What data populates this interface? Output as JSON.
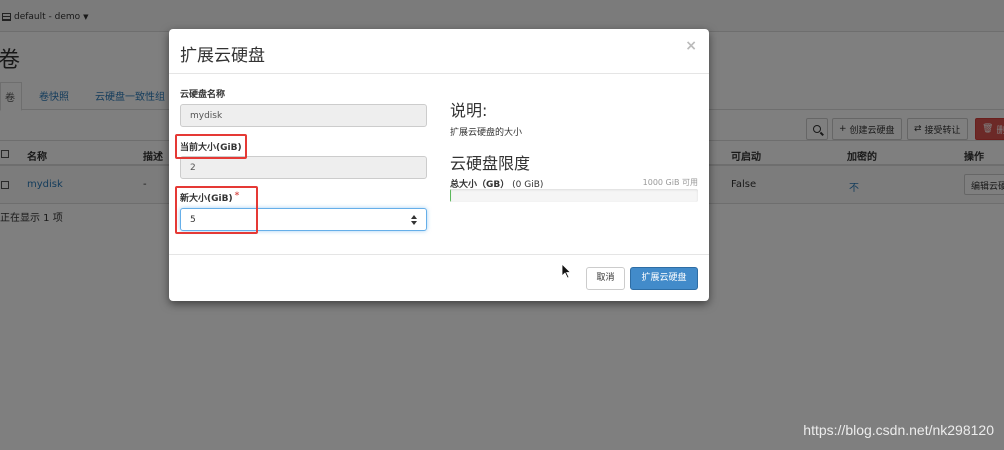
{
  "topbar": {
    "project_label": "default - demo"
  },
  "page": {
    "title": "卷"
  },
  "tabs": [
    {
      "label": "卷"
    },
    {
      "label": "卷快照"
    },
    {
      "label": "云硬盘一致性组"
    }
  ],
  "toolbar": {
    "create_label": "创建云硬盘",
    "accept_transfer_label": "接受转让",
    "delete_label": "删"
  },
  "table": {
    "headers": {
      "name": "名称",
      "description": "描述",
      "bootable": "可启动",
      "encrypted": "加密的",
      "actions": "操作"
    },
    "rows": [
      {
        "name": "mydisk",
        "description": "-",
        "bootable": "False",
        "encrypted": "不",
        "action": "编辑云硬"
      }
    ],
    "footer": "正在显示 1 项"
  },
  "modal": {
    "title": "扩展云硬盘",
    "close_glyph": "×",
    "name_label": "云硬盘名称",
    "name_value": "mydisk",
    "current_size_label": "当前大小(GiB)",
    "current_size_value": "2",
    "new_size_label": "新大小(GiB)",
    "new_size_required": "*",
    "new_size_value": "5",
    "description_title": "说明:",
    "description_text": "扩展云硬盘的大小",
    "quota_title": "云硬盘限度",
    "quota_total_label": "总大小（GB）",
    "quota_used": "(0 GiB)",
    "quota_available": "1000 GiB 可用",
    "quota_used_fraction": 0.0,
    "cancel_label": "取消",
    "submit_label": "扩展云硬盘"
  },
  "watermark": "https://blog.csdn.net/nk298120",
  "colors": {
    "primary": "#428bca",
    "danger": "#d9534f",
    "highlight": "#e53935",
    "link": "#2a7ab9"
  }
}
